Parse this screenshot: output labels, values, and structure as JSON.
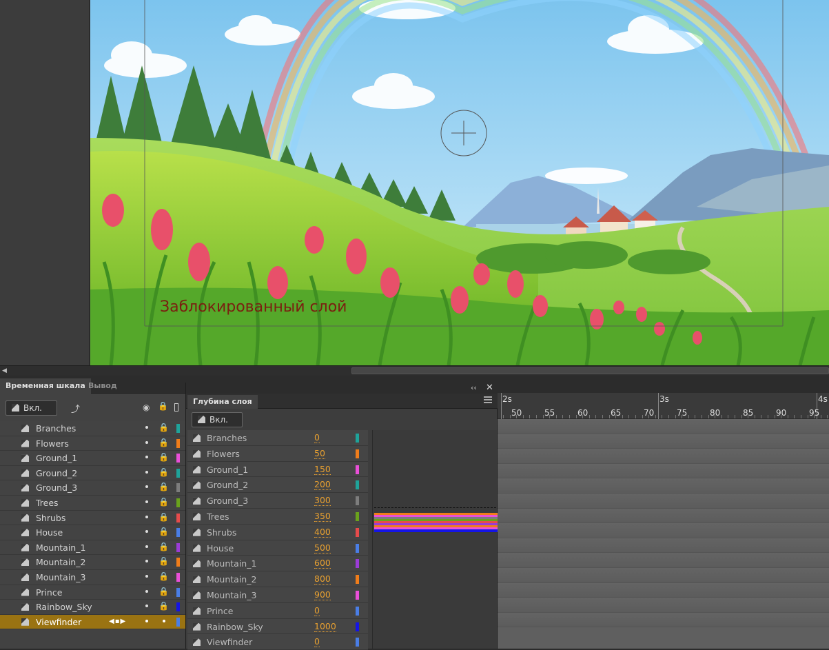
{
  "stage": {
    "locked_layer_text": "Заблокированный слой"
  },
  "tabs": {
    "timeline": "Временная шкала",
    "output": "Вывод"
  },
  "timeline_toolbar": {
    "layer_toggle_label": "Вкл."
  },
  "layers": [
    {
      "name": "Branches",
      "color": "#1fa39a"
    },
    {
      "name": "Flowers",
      "color": "#f07d1a"
    },
    {
      "name": "Ground_1",
      "color": "#ea4fd8"
    },
    {
      "name": "Ground_2",
      "color": "#1fa39a"
    },
    {
      "name": "Ground_3",
      "color": "#7d7d7d"
    },
    {
      "name": "Trees",
      "color": "#6aa21c"
    },
    {
      "name": "Shrubs",
      "color": "#e64b4b"
    },
    {
      "name": "House",
      "color": "#4a7ee6"
    },
    {
      "name": "Mountain_1",
      "color": "#9b3cd6"
    },
    {
      "name": "Mountain_2",
      "color": "#f07d1a"
    },
    {
      "name": "Mountain_3",
      "color": "#ea4fd8"
    },
    {
      "name": "Prince",
      "color": "#4a7ee6"
    },
    {
      "name": "Rainbow_Sky",
      "color": "#1414e6"
    },
    {
      "name": "Viewfinder",
      "color": "#4a7ee6"
    }
  ],
  "depth_panel": {
    "title": "Глубина слоя",
    "toggle_label": "Вкл.",
    "rows": [
      {
        "name": "Branches",
        "value": "0",
        "color": "#1fa39a"
      },
      {
        "name": "Flowers",
        "value": "50",
        "color": "#f07d1a"
      },
      {
        "name": "Ground_1",
        "value": "150",
        "color": "#ea4fd8"
      },
      {
        "name": "Ground_2",
        "value": "200",
        "color": "#1fa39a"
      },
      {
        "name": "Ground_3",
        "value": "300",
        "color": "#7d7d7d"
      },
      {
        "name": "Trees",
        "value": "350",
        "color": "#6aa21c"
      },
      {
        "name": "Shrubs",
        "value": "400",
        "color": "#e64b4b"
      },
      {
        "name": "House",
        "value": "500",
        "color": "#4a7ee6"
      },
      {
        "name": "Mountain_1",
        "value": "600",
        "color": "#9b3cd6"
      },
      {
        "name": "Mountain_2",
        "value": "800",
        "color": "#f07d1a"
      },
      {
        "name": "Mountain_3",
        "value": "900",
        "color": "#ea4fd8"
      },
      {
        "name": "Prince",
        "value": "0",
        "color": "#4a7ee6"
      },
      {
        "name": "Rainbow_Sky",
        "value": "1000",
        "color": "#1414e6"
      },
      {
        "name": "Viewfinder",
        "value": "0",
        "color": "#4a7ee6"
      }
    ],
    "graph_bar_colors": [
      "#f07d1a",
      "#ea4fd8",
      "#7d7d7d",
      "#6aa21c",
      "#e64b4b",
      "#9b3cd6",
      "#f07d1a",
      "#ea4fd8",
      "#1414e6"
    ]
  },
  "ruler": {
    "seconds": [
      "2s",
      "3s",
      "4s"
    ],
    "frames": [
      "50",
      "55",
      "60",
      "65",
      "70",
      "75",
      "80",
      "85",
      "90",
      "95"
    ]
  },
  "colors": {
    "selected_layer_bg": "#9a7312",
    "depth_value": "#e8a030"
  }
}
